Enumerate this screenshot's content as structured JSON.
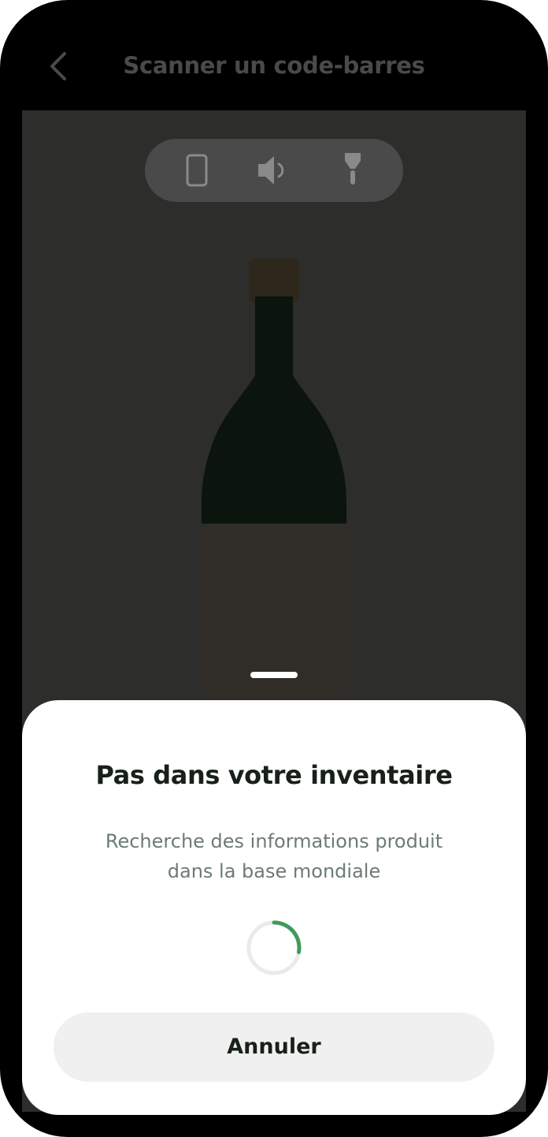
{
  "header": {
    "title": "Scanner un code-barres",
    "back_icon": "chevron-left-icon"
  },
  "camera_controls": [
    {
      "icon": "phone-icon"
    },
    {
      "icon": "speaker-icon"
    },
    {
      "icon": "flashlight-icon"
    }
  ],
  "sheet": {
    "title": "Pas dans votre inventaire",
    "description_line1": "Recherche des informations produit",
    "description_line2": "dans la base mondiale",
    "cancel_label": "Annuler"
  },
  "colors": {
    "accent": "#3f9a5c",
    "title": "#172019",
    "muted_text": "#6c7c72",
    "button_bg": "#f0f0f0"
  }
}
